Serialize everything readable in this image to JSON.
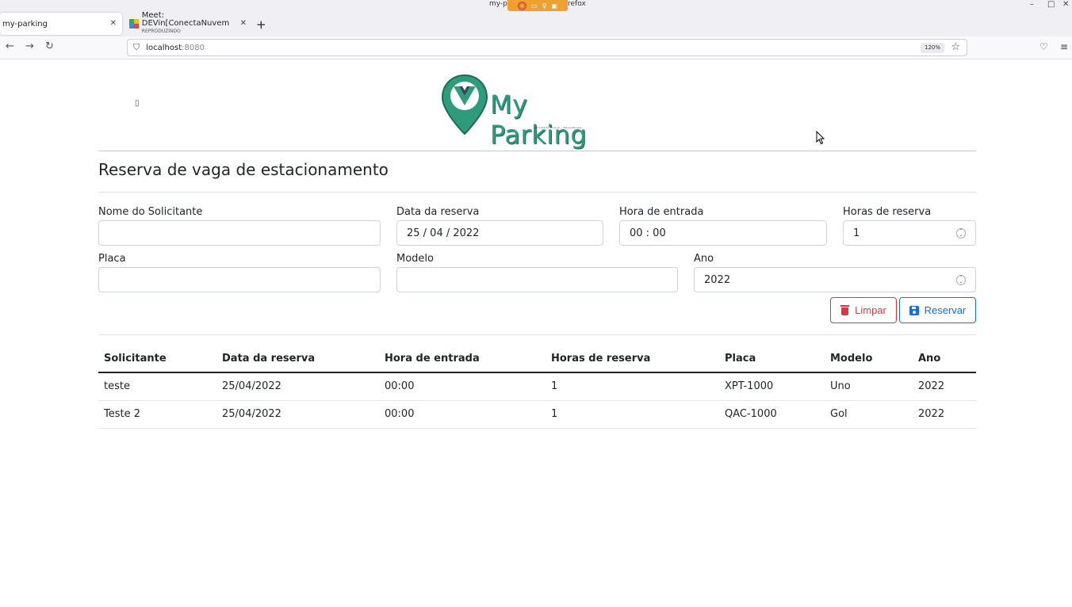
{
  "browser": {
    "window_title_left": "my-pa",
    "window_title_right": "refox",
    "tabs": [
      {
        "label": "my-parking",
        "sub": ""
      },
      {
        "label": "Meet: DEVin[ConectaNuvem",
        "sub": "REPRODUZINDO"
      }
    ],
    "url_host": "localhost",
    "url_port": ":8080",
    "zoom": "120%"
  },
  "logo": {
    "text": "My Parking",
    "subtext": "Atividade Vue.js - DevinHouse"
  },
  "form": {
    "title": "Reserva de vaga de estacionamento",
    "labels": {
      "nome": "Nome do Solicitante",
      "data": "Data da reserva",
      "hora": "Hora de entrada",
      "horas": "Horas de reserva",
      "placa": "Placa",
      "modelo": "Modelo",
      "ano": "Ano"
    },
    "values": {
      "nome": "",
      "data": "25 / 04 / 2022",
      "hora": "00 : 00",
      "horas": "1",
      "placa": "",
      "modelo": "",
      "ano": "2022"
    },
    "buttons": {
      "clear": "Limpar",
      "save": "Reservar"
    }
  },
  "table": {
    "headers": [
      "Solicitante",
      "Data da reserva",
      "Hora de entrada",
      "Horas de reserva",
      "Placa",
      "Modelo",
      "Ano"
    ],
    "rows": [
      [
        "teste",
        "25/04/2022",
        "00:00",
        "1",
        "XPT-1000",
        "Uno",
        "2022"
      ],
      [
        "Teste 2",
        "25/04/2022",
        "00:00",
        "1",
        "QAC-1000",
        "Gol",
        "2022"
      ]
    ]
  },
  "colors": {
    "brand": "#2e9b7a",
    "danger": "#dc3545",
    "primary": "#0d6efd"
  }
}
